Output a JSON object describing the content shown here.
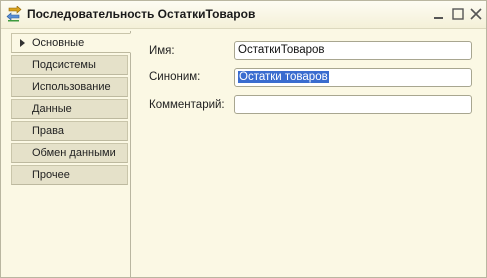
{
  "window": {
    "title": "Последовательность ОстаткиТоваров",
    "icon": "sequence-icon",
    "controls": [
      "minimize",
      "maximize",
      "close"
    ]
  },
  "tabs": [
    {
      "label": "Основные",
      "active": true
    },
    {
      "label": "Подсистемы",
      "active": false
    },
    {
      "label": "Использование",
      "active": false
    },
    {
      "label": "Данные",
      "active": false
    },
    {
      "label": "Права",
      "active": false
    },
    {
      "label": "Обмен данными",
      "active": false
    },
    {
      "label": "Прочее",
      "active": false
    }
  ],
  "form": {
    "name_label": "Имя:",
    "name_value": "ОстаткиТоваров",
    "synonym_label": "Синоним:",
    "synonym_value": "Остатки товаров",
    "comment_label": "Комментарий:",
    "comment_value": ""
  },
  "colors": {
    "background": "#fbf8e4",
    "tab_inactive": "#e5e1c9",
    "selection": "#3a6ccf"
  }
}
